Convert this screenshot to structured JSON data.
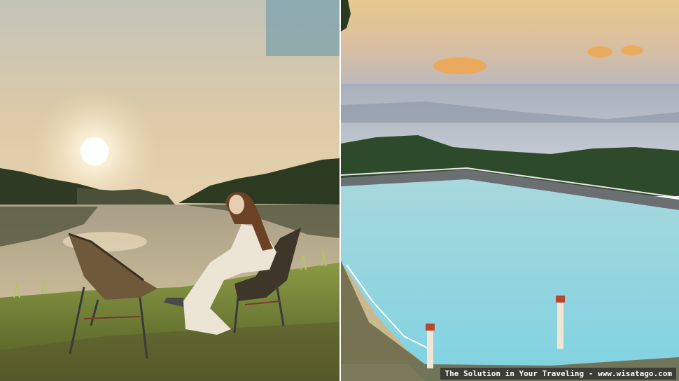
{
  "scenes": {
    "left": {
      "subject": "lakeside-sunrise-woman-in-chair"
    },
    "right": {
      "subject": "hilltop-reservoir-with-walkway"
    }
  },
  "watermark": {
    "text": "The Solution in Your Traveling - www.wisatago.com"
  },
  "colors": {
    "sky_left": "#d9c7a3",
    "lake_left": "#b8ab8c",
    "grass": "#7a8a3a",
    "reservoir_water": "#8fd6e0",
    "sky_right_top": "#e8c98a",
    "watermark_bg": "#2a2a2a"
  }
}
